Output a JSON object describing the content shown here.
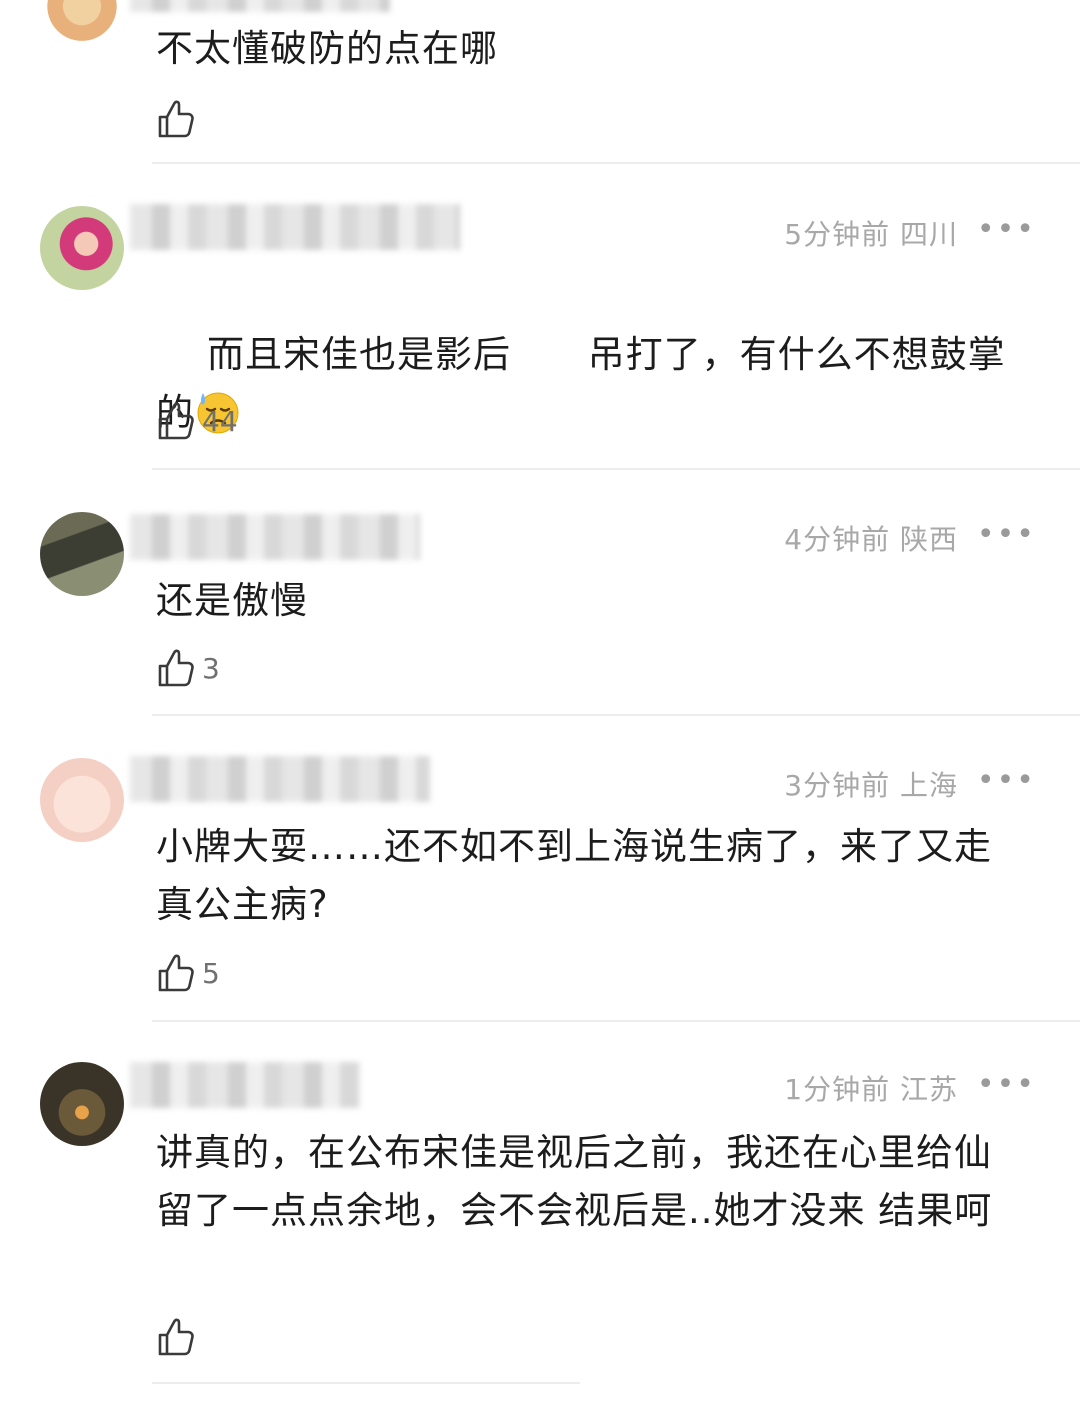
{
  "comments": [
    {
      "text": "不太懂破防的点在哪",
      "likes": "",
      "time": "",
      "location": "",
      "more": ""
    },
    {
      "text": "而且宋佳也是影后      吊打了，有什么不想鼓掌的",
      "likes": "44",
      "time": "5分钟前",
      "location": "四川",
      "more": "•••",
      "emoji": "downcast-sweat-face"
    },
    {
      "text": "还是傲慢",
      "likes": "3",
      "time": "4分钟前",
      "location": "陕西",
      "more": "•••"
    },
    {
      "text": "小牌大耍……还不如不到上海说生病了，来了又走真公主病?",
      "likes": "5",
      "time": "3分钟前",
      "location": "上海",
      "more": "•••"
    },
    {
      "text": "讲真的，在公布宋佳是视后之前，我还在心里给仙留了一点点余地，会不会视后是..她才没来 结果呵",
      "likes": "",
      "time": "1分钟前",
      "location": "江苏",
      "more": "•••"
    }
  ],
  "colors": {
    "meta_gray": "#a8a8a8",
    "divider": "#ededed",
    "text": "#1c1c1c"
  },
  "icons": [
    "thumbs-up-icon",
    "more-options-icon"
  ]
}
